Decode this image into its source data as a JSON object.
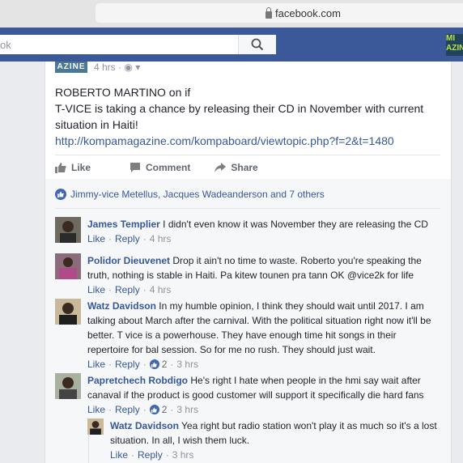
{
  "browser": {
    "url": "facebook.com"
  },
  "header": {
    "search_text": "ok",
    "corner_logo": "MI AZINE"
  },
  "post": {
    "page_logo": "AZINE",
    "timestamp": "4 hrs",
    "line1": "ROBERTO MARTINO on if",
    "line2": "T-VICE is taking a chance by releasing their CD in November with current situation in Haiti!",
    "link": "http://kompamagazine.com/kompaboard/viewtopic.php?f=2&t=1480",
    "actions": {
      "like": "Like",
      "comment": "Comment",
      "share": "Share"
    },
    "likes_summary": "Jimmy-vice Metellus, Jacques Wadeanderson and 7 others"
  },
  "comments": [
    {
      "name": "James Templier",
      "text": "I didn't even know it was November they are releasing the CD",
      "like": "Like",
      "reply": "Reply",
      "time": "4 hrs",
      "reactions": ""
    },
    {
      "name": "Polidor Dieuvenet",
      "text": "Drop it ain't no time to waste. Roberto you're speaking the truth, nothing is stable in Haiti. Pa kitew tounen pra tann OK @vice2k for life",
      "like": "Like",
      "reply": "Reply",
      "time": "4 hrs",
      "reactions": ""
    },
    {
      "name": "Watz Davidson",
      "text": "In my humble opinion, I think they should wait until 2017. I am talking about March after the carnival. With the political situation right now it'll be better. T vice is a powerhouse. They have enough time hit songs in their repertoire for bal session. So for me no rush. They should just wait.",
      "like": "Like",
      "reply": "Reply",
      "time": "3 hrs",
      "reactions": "2"
    },
    {
      "name": "Papretchech Robdigo",
      "text": "He's right I hate when people in the hmi say wait after canaval if the product is good customer will support it specifically die hard fans",
      "like": "Like",
      "reply": "Reply",
      "time": "3 hrs",
      "reactions": "2"
    }
  ],
  "reply": {
    "name": "Watz Davidson",
    "text": "Yea right but radio station won't play it as much so it's a lost situation. In all, I wish them luck.",
    "like": "Like",
    "reply": "Reply",
    "time": "3 hrs"
  }
}
